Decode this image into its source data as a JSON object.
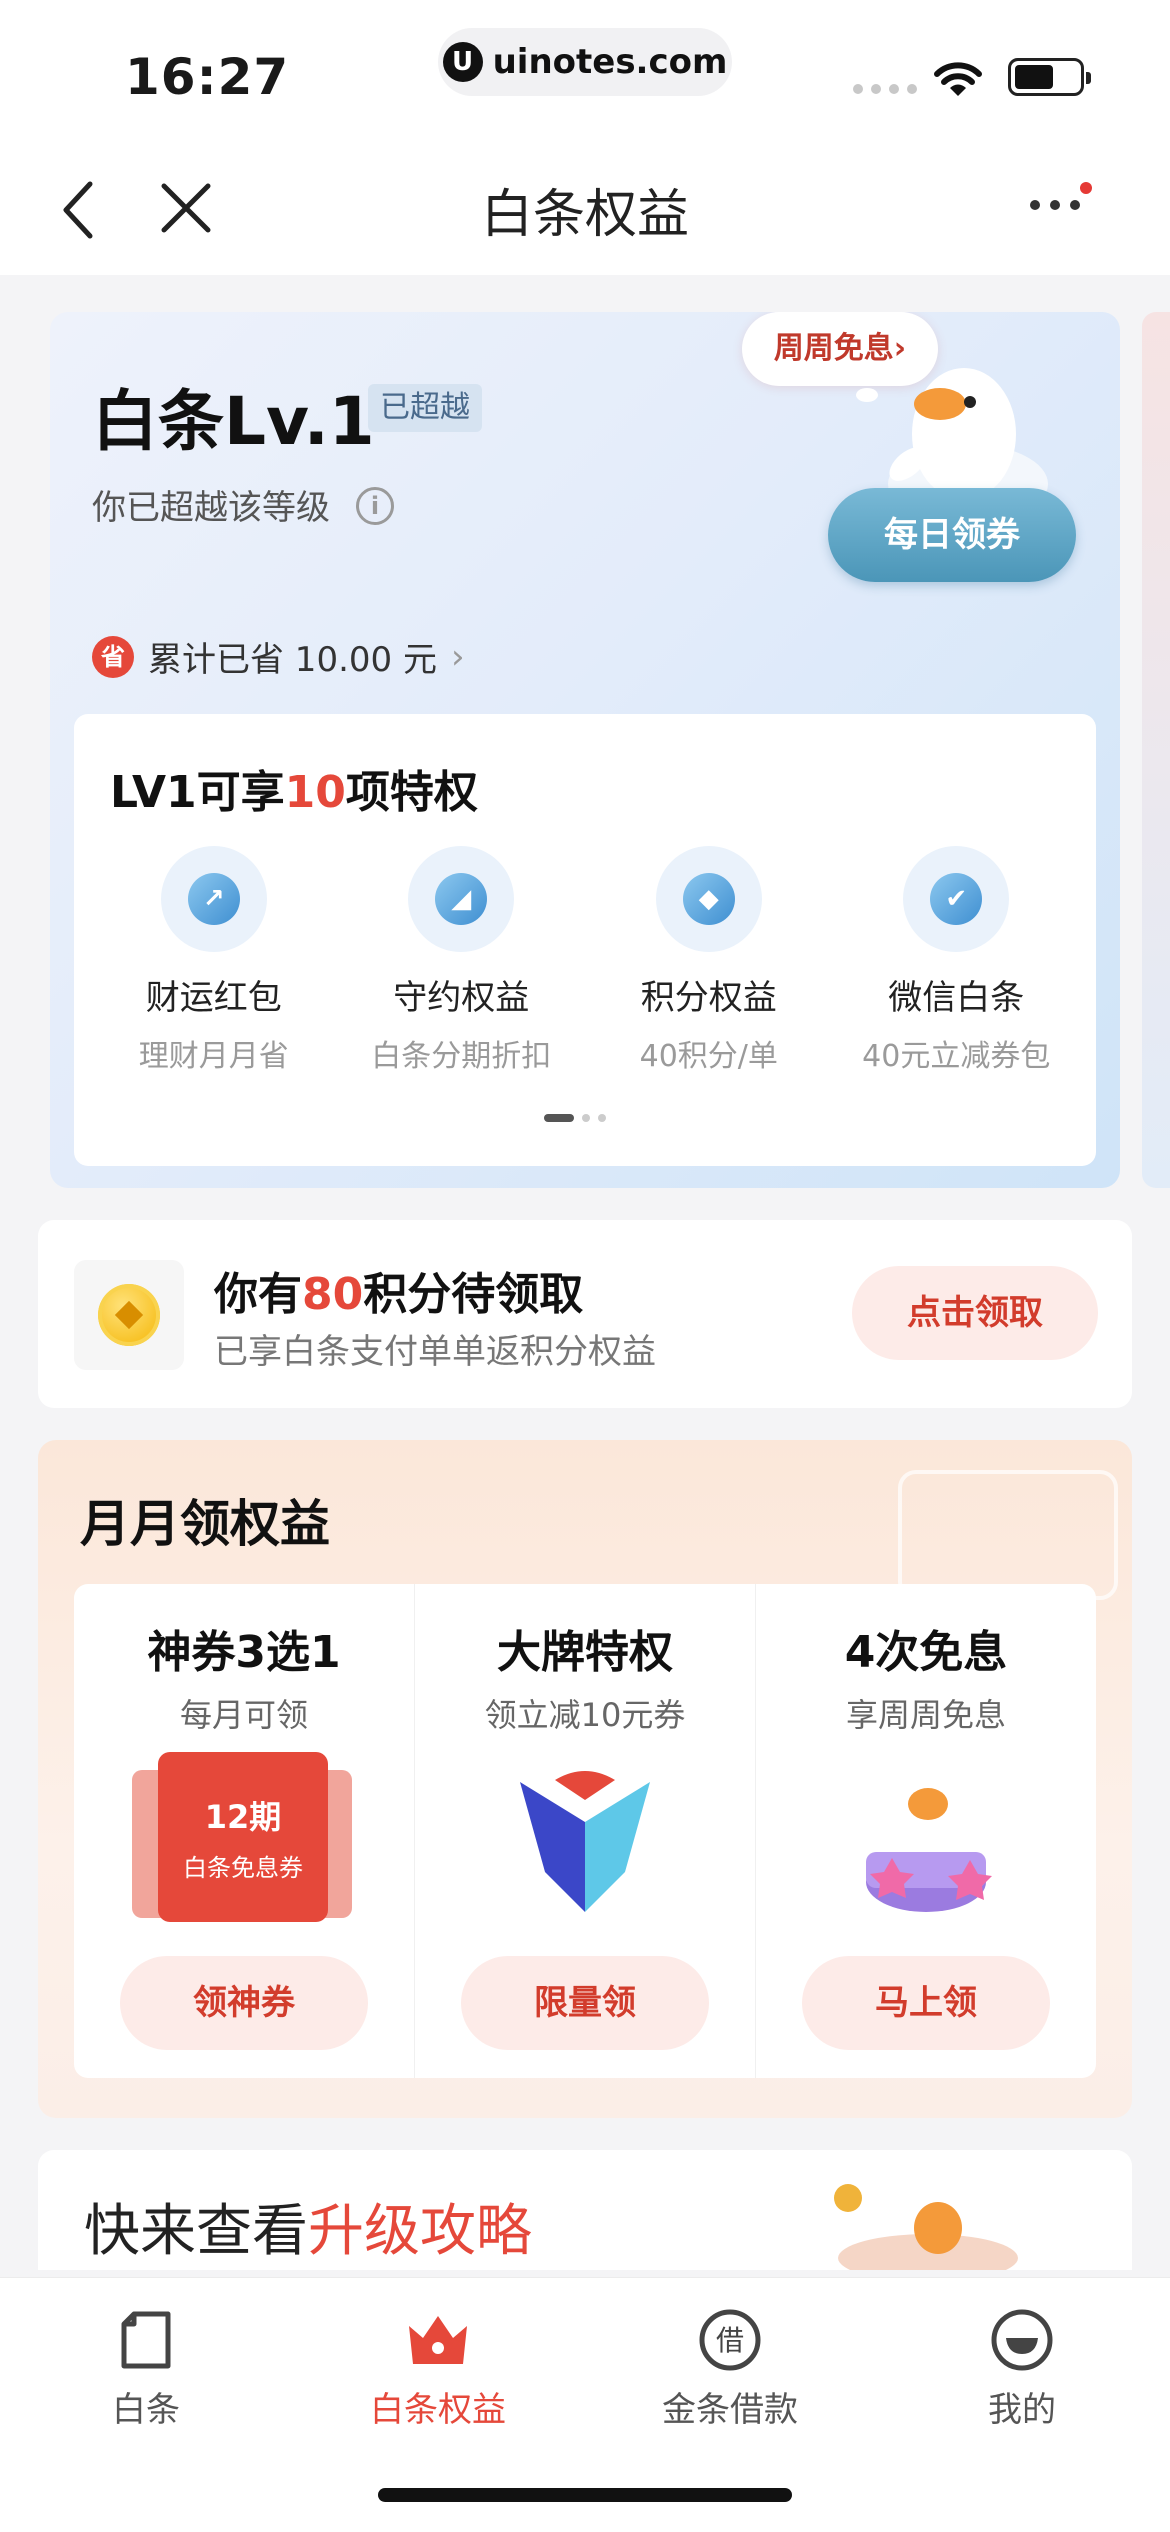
{
  "status_bar": {
    "time": "16:27",
    "url": "uinotes.com"
  },
  "nav": {
    "title": "白条权益"
  },
  "level_card": {
    "level": "白条Lv.1",
    "badge": "已超越",
    "subtitle": "你已超越该等级",
    "bubble": "周周免息›",
    "daily_button": "每日领券",
    "saved_icon": "省",
    "saved_text": "累计已省 10.00 元",
    "privileges": {
      "title_prefix": "LV1可享",
      "title_count": "10",
      "title_suffix": "项特权",
      "items": [
        {
          "name": "财运红包",
          "desc": "理财月月省"
        },
        {
          "name": "守约权益",
          "desc": "白条分期折扣"
        },
        {
          "name": "积分权益",
          "desc": "40积分/单"
        },
        {
          "name": "微信白条",
          "desc": "40元立减券包"
        }
      ]
    }
  },
  "points_card": {
    "title_prefix": "你有",
    "points": "80",
    "title_suffix": "积分待领取",
    "subtitle": "已享白条支付单单返积分权益",
    "button": "点击领取"
  },
  "monthly_card": {
    "title": "月月领权益",
    "columns": [
      {
        "title": "神券3选1",
        "subtitle": "每月可领",
        "coupon_line1": "12期",
        "coupon_line2": "白条免息券",
        "button": "领神券"
      },
      {
        "title": "大牌特权",
        "subtitle": "领立减10元券",
        "button": "限量领"
      },
      {
        "title": "4次免息",
        "subtitle": "享周周免息",
        "button": "马上领"
      }
    ]
  },
  "upgrade_card": {
    "title_prefix": "快来查看",
    "title_highlight": "升级攻略"
  },
  "tabbar": {
    "tabs": [
      {
        "label": "白条",
        "icon": "note-icon"
      },
      {
        "label": "白条权益",
        "icon": "crown-icon"
      },
      {
        "label": "金条借款",
        "icon": "borrow-icon"
      },
      {
        "label": "我的",
        "icon": "profile-icon"
      }
    ],
    "active_index": 1
  },
  "colors": {
    "accent": "#e5483a",
    "button_blue": "#4b96b8"
  }
}
